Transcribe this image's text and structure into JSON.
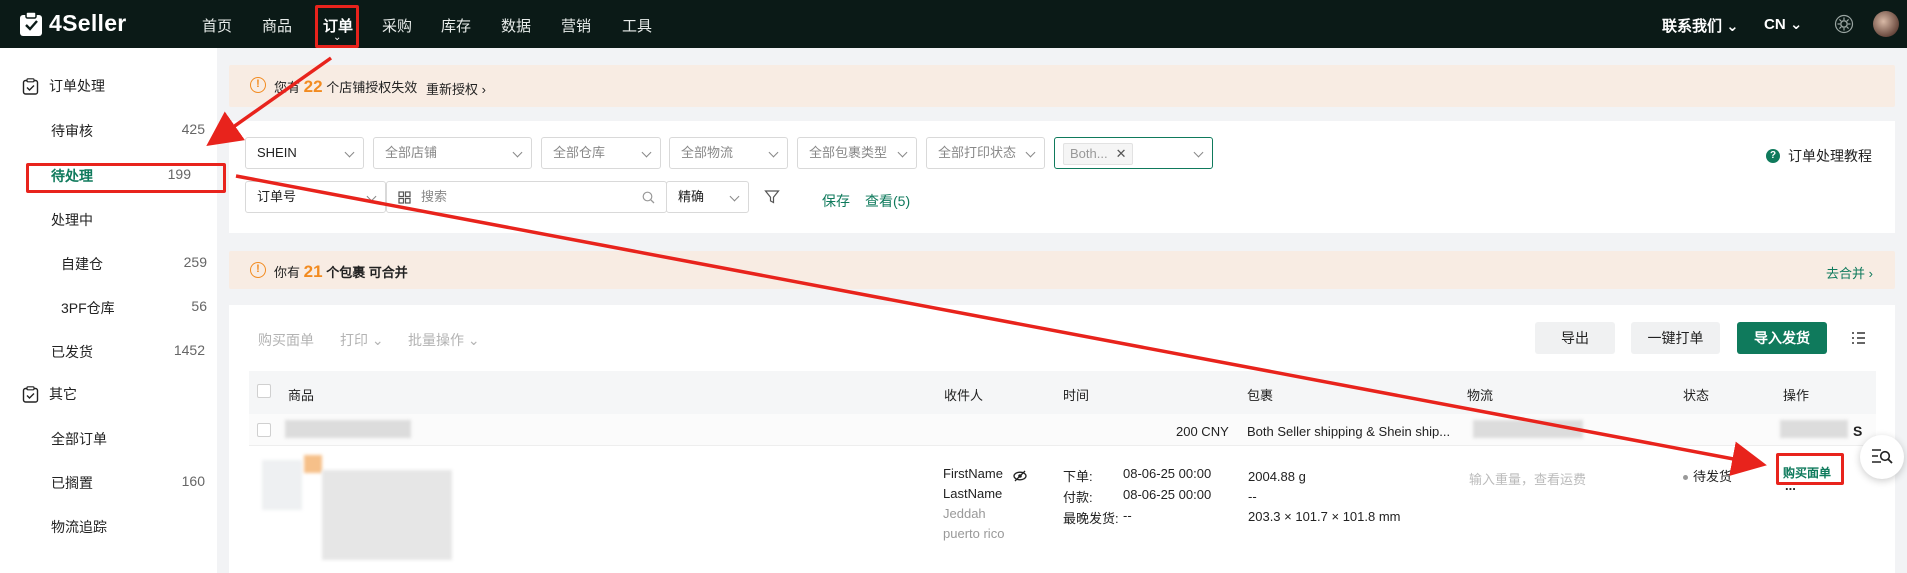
{
  "brand": {
    "name": "4Seller"
  },
  "nav": {
    "items": [
      "首页",
      "商品",
      "订单",
      "采购",
      "库存",
      "数据",
      "营销",
      "工具"
    ],
    "contact": "联系我们",
    "lang": "CN"
  },
  "sidebar": {
    "group1": "订单处理",
    "pending_review": {
      "label": "待审核",
      "count": "425"
    },
    "pending": {
      "label": "待处理",
      "count": "199"
    },
    "processing": {
      "label": "处理中"
    },
    "self_wh": {
      "label": "自建仓",
      "count": "259"
    },
    "tpf_wh": {
      "label": "3PF仓库",
      "count": "56"
    },
    "shipped": {
      "label": "已发货",
      "count": "1452"
    },
    "group2": "其它",
    "all_orders": {
      "label": "全部订单"
    },
    "on_hold": {
      "label": "已搁置",
      "count": "160"
    },
    "tracking": {
      "label": "物流追踪"
    }
  },
  "banner1": {
    "prefix": "您有",
    "count": "22",
    "suffix": "个店铺授权失效",
    "action": "重新授权"
  },
  "filters": {
    "platform": "SHEIN",
    "store": "全部店铺",
    "warehouse": "全部仓库",
    "logistics": "全部物流",
    "package_type": "全部包裹类型",
    "print_status": "全部打印状态",
    "tag": "Both...",
    "search_field": "订单号",
    "search_placeholder": "搜索",
    "match": "精确",
    "save": "保存",
    "view": "查看(5)",
    "tutorial": "订单处理教程"
  },
  "banner2": {
    "prefix": "你有",
    "count": "21",
    "suffix": "个包裹 可合并",
    "action": "去合并"
  },
  "toolbar": {
    "buy_label": "购买面单",
    "print": "打印",
    "batch": "批量操作",
    "export": "导出",
    "one_click": "一键打单",
    "import_ship": "导入发货"
  },
  "table": {
    "headers": {
      "product": "商品",
      "recipient": "收件人",
      "time": "时间",
      "package": "包裹",
      "logistics": "物流",
      "status": "状态",
      "action": "操作"
    },
    "summary": {
      "amount": "200 CNY",
      "shipping": "Both Seller shipping & Shein ship...",
      "suffix": "S"
    },
    "order": {
      "first_name": "FirstName",
      "last_name": "LastName",
      "city": "Jeddah",
      "region": "puerto rico",
      "order_label": "下单:",
      "order_time": "08-06-25 00:00",
      "pay_label": "付款:",
      "pay_time": "08-06-25 00:00",
      "ship_label": "最晚发货:",
      "ship_time": "--",
      "weight": "2004.88 g",
      "dash": "--",
      "dims": "203.3 × 101.7 × 101.8 mm",
      "logistics_hint": "输入重量，查看运费",
      "status": "待发货",
      "buy_label": "购买面单",
      "more": "..."
    }
  },
  "colors": {
    "brand": "#0f7a5c",
    "nav_bg": "#0b1a17",
    "warning": "#f28b20",
    "annotation": "#e8231c"
  }
}
